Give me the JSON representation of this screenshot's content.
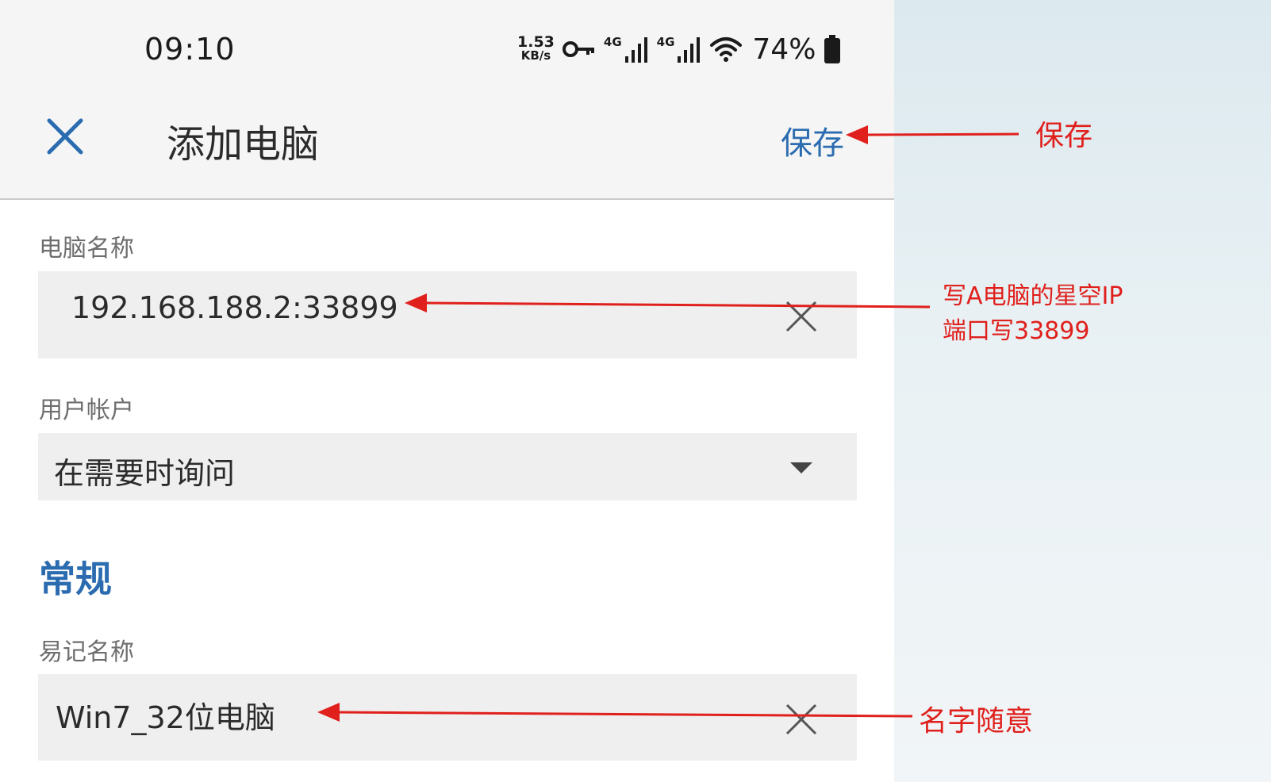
{
  "status_bar": {
    "time": "09:10",
    "net_speed_value": "1.53",
    "net_speed_unit": "KB/s",
    "signal_1_label": "4G",
    "signal_2_label": "4G",
    "battery_percent": "74%",
    "icons": [
      "key-icon",
      "signal-icon",
      "signal-icon",
      "wifi-icon",
      "battery-icon"
    ]
  },
  "app_bar": {
    "title": "添加电脑",
    "save_label": "保存",
    "close_icon": "close-icon"
  },
  "form": {
    "pc_name_label": "电脑名称",
    "pc_name_value": "192.168.188.2:33899",
    "user_account_label": "用户帐户",
    "user_account_value": "在需要时询问",
    "section_general": "常规",
    "friendly_name_label": "易记名称",
    "friendly_name_value": "Win7_32位电脑"
  },
  "annotations": {
    "save": "保存",
    "ip_line1": "写A电脑的星空IP",
    "ip_line2": "端口写33899",
    "name": "名字随意"
  },
  "colors": {
    "accent": "#2b6cb0",
    "annotation": "#e0201c",
    "field_bg": "#efefef",
    "bar_bg": "#f5f5f5"
  }
}
